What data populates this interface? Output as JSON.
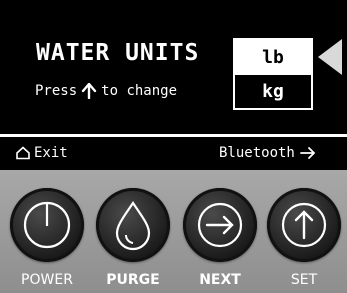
{
  "screen": {
    "title": "WATER UNITS",
    "hint_before": "Press",
    "hint_after": "to change",
    "unit_options": [
      "lb",
      "kg"
    ],
    "selected_unit": "lb",
    "exit_label": "Exit",
    "bluetooth_label": "Bluetooth"
  },
  "buttons": {
    "power": "POWER",
    "purge": "PURGE",
    "next": "NEXT",
    "set": "SET"
  },
  "colors": {
    "screen_bg": "#000000",
    "panel_bg": "#9a9a9a",
    "button_face": "#1f1f1f",
    "text": "#ffffff"
  }
}
